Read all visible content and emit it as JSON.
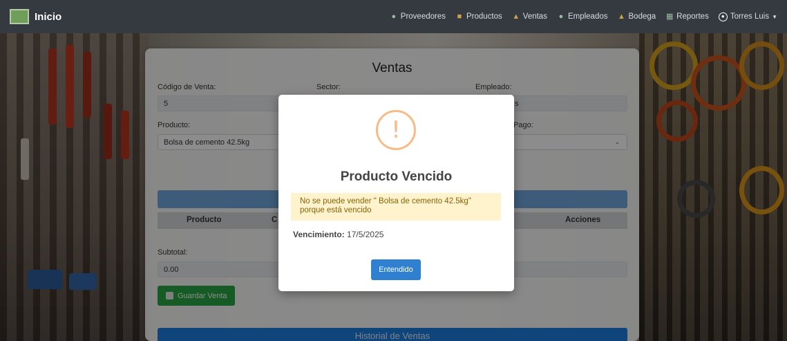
{
  "navbar": {
    "brand": "Inicio",
    "links": [
      {
        "label": "Proveedores",
        "icon": "suppliers-icon"
      },
      {
        "label": "Productos",
        "icon": "products-icon"
      },
      {
        "label": "Ventas",
        "icon": "sales-icon"
      },
      {
        "label": "Empleados",
        "icon": "employees-icon"
      },
      {
        "label": "Bodega",
        "icon": "warehouse-icon"
      },
      {
        "label": "Reportes",
        "icon": "reports-icon"
      }
    ],
    "user": "Torres Luis"
  },
  "form": {
    "title": "Ventas",
    "codigo_label": "Código de Venta:",
    "codigo_value": "5",
    "sector_label": "Sector:",
    "empleado_label": "Empleado:",
    "empleado_value_partial": "s",
    "producto_label": "Producto:",
    "producto_value": "Bolsa de cemento 42.5kg",
    "pago_label_partial": "Pago:",
    "table_headers": [
      "Producto",
      "C",
      "Acciones"
    ],
    "subtotal_label": "Subtotal:",
    "subtotal_value": "0.00",
    "save_button": "Guardar Venta",
    "history_bar": "Historial de Ventas"
  },
  "modal": {
    "icon": "warning-icon",
    "icon_glyph": "!",
    "title": "Producto Vencido",
    "alert_text": "No se puede vender \" Bolsa de cemento 42.5kg\" porque está vencido",
    "vencimiento_label": "Vencimiento:",
    "vencimiento_value": "17/5/2025",
    "button": "Entendido"
  },
  "colors": {
    "navbar": "#343a40",
    "warning": "#f8bb86",
    "alert_bg": "#fff3cd",
    "primary": "#2f80d1",
    "success": "#28a745",
    "info_bar": "#6fa8dc"
  }
}
